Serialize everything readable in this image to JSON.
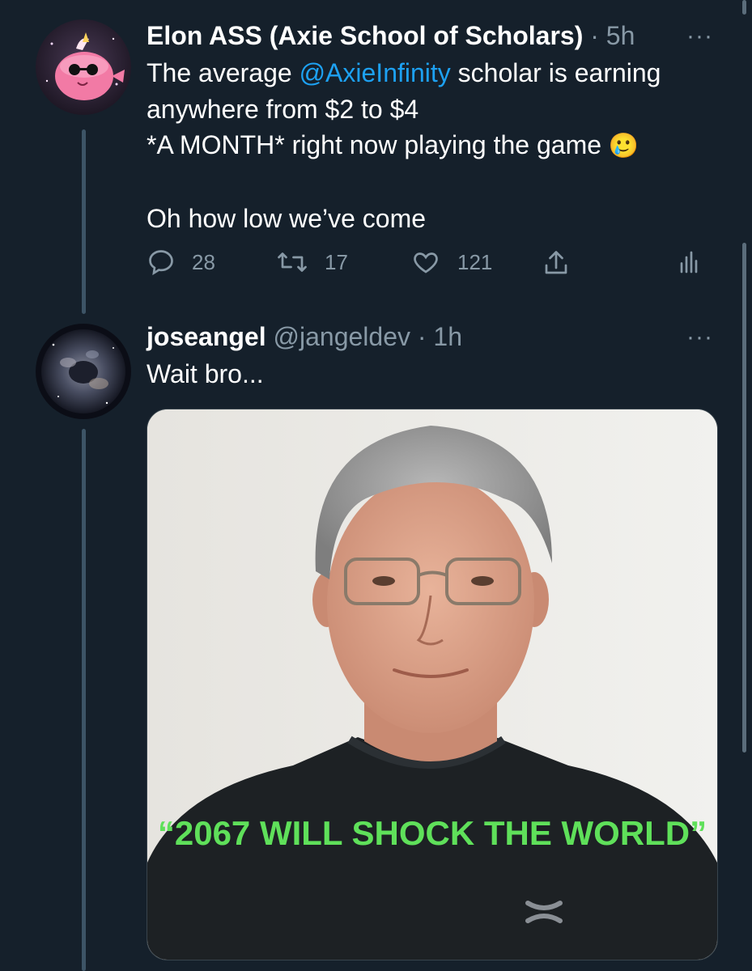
{
  "tweets": [
    {
      "author_name": "Elon ASS (Axie School of Scholars)",
      "meta": " · 5h",
      "more": "···",
      "text": {
        "line1_pre": "The average ",
        "mention": "@AxieInfinity",
        "line1_post": " scholar is earning",
        "line2": "anywhere from $2 to $4",
        "line3": "*A MONTH* right now playing the game ",
        "emoji": "🥲",
        "line5": "Oh how low we’ve come"
      },
      "stats": {
        "replies": "28",
        "retweets": "17",
        "likes": "121"
      },
      "icons": {
        "reply": "reply-icon",
        "retweet": "retweet-icon",
        "like": "heart-icon",
        "share": "share-icon",
        "analytics": "analytics-icon"
      }
    },
    {
      "author_name": "joseangel",
      "meta": " @jangeldev · 1h",
      "more": "···",
      "text": {
        "line1": "Wait bro..."
      },
      "media": {
        "caption": "“2067 WILL SHOCK THE WORLD”"
      }
    }
  ],
  "colors": {
    "background": "#15202b",
    "accent": "#1da1f2",
    "muted": "#8899a6",
    "caption_green": "#5fe05a"
  }
}
